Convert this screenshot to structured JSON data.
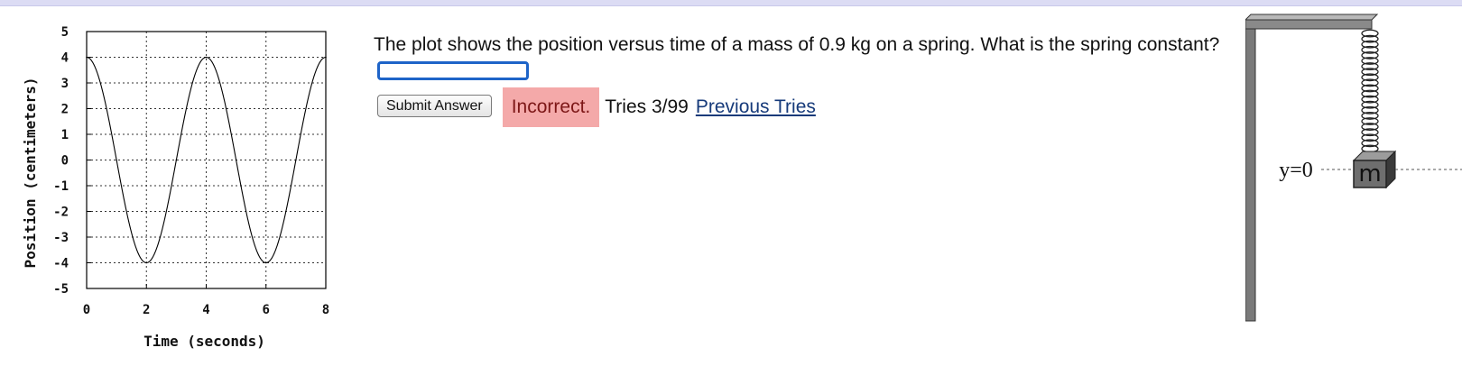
{
  "question": {
    "text": "The plot shows the position versus time of a mass of 0.9 kg on a spring. What is the spring constant?",
    "answer_value": ""
  },
  "controls": {
    "submit_label": "Submit Answer",
    "status_text": "Incorrect.",
    "tries_text": "Tries 3/99",
    "previous_tries_label": "Previous Tries"
  },
  "diagram": {
    "mass_label": "m",
    "equilibrium_label": "y=0"
  },
  "colors": {
    "input_border": "#1e64c8",
    "status_background": "#f4a9a9",
    "link": "#163a7a"
  },
  "chart_data": {
    "type": "line",
    "xlabel": "Time (seconds)",
    "ylabel": "Position (centimeters)",
    "xlim": [
      0,
      8
    ],
    "ylim": [
      -5,
      5
    ],
    "x_ticks": [
      0,
      2,
      4,
      6,
      8
    ],
    "y_ticks": [
      5,
      4,
      3,
      2,
      1,
      0,
      -1,
      -2,
      -3,
      -4,
      -5
    ],
    "grid": true,
    "grid_style": "dotted",
    "series": [
      {
        "function": "cosine",
        "amplitude": 4,
        "period": 4,
        "x": [
          0,
          1,
          2,
          3,
          4,
          5,
          6,
          7,
          8
        ],
        "y": [
          4,
          0,
          -4,
          0,
          4,
          0,
          -4,
          0,
          4
        ]
      }
    ]
  }
}
